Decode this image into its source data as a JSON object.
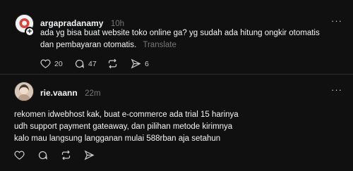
{
  "post": {
    "username": "argapradanamy",
    "time": "10h",
    "lines": [
      "ada yg bisa buat website toko online ga? yg sudah ada hitung ongkir otomatis",
      "dan pembayaran otomatis."
    ],
    "translate_label": "Translate",
    "actions": {
      "likes": "20",
      "comments": "47",
      "shares": "6"
    },
    "more": "···"
  },
  "reply": {
    "username": "rie.vaann",
    "time": "22m",
    "lines": [
      "rekomen idwebhost kak, buat e-commerce ada trial 15 harinya",
      "udh support payment gateaway, dan pilihan metode kirimnya",
      "kalo mau langsung langganan mulai 588rban aja setahun"
    ],
    "more": "···"
  },
  "icons": {
    "like": "heart-icon",
    "comment": "comment-icon",
    "repost": "repost-icon",
    "share": "send-icon",
    "more": "more-icon"
  }
}
